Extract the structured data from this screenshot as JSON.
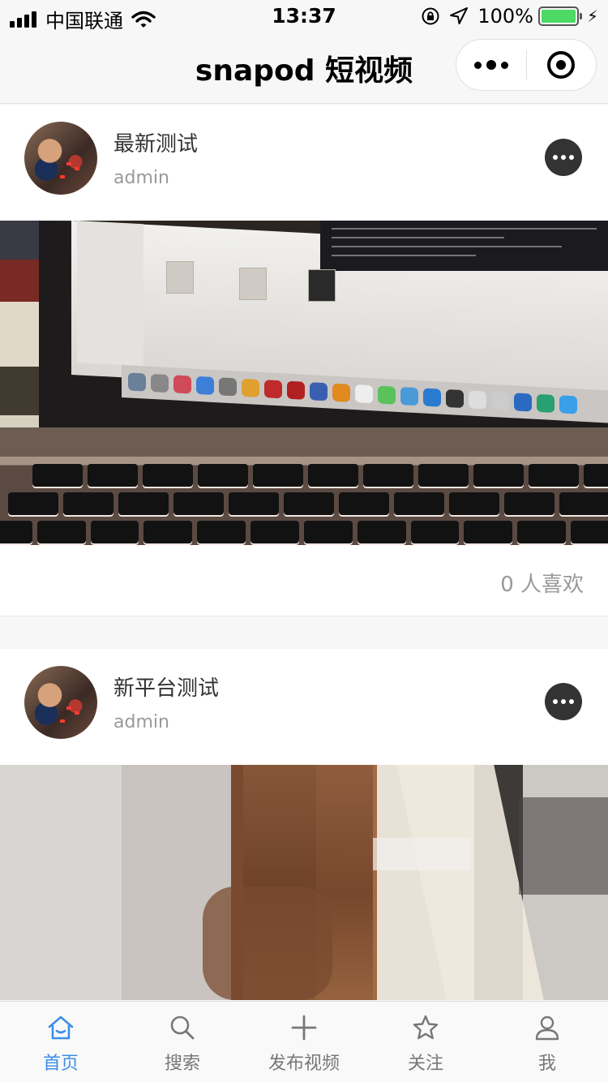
{
  "status_bar": {
    "carrier": "中国联通",
    "time": "13:37",
    "battery_percent": "100%"
  },
  "nav": {
    "title": "snapod 短视频"
  },
  "posts": [
    {
      "title": "最新测试",
      "author": "admin",
      "likes": "0 人喜欢"
    },
    {
      "title": "新平台测试",
      "author": "admin"
    }
  ],
  "tabs": [
    {
      "label": "首页",
      "icon": "home-icon",
      "active": true
    },
    {
      "label": "搜索",
      "icon": "search-icon",
      "active": false
    },
    {
      "label": "发布视频",
      "icon": "plus-icon",
      "active": false
    },
    {
      "label": "关注",
      "icon": "star-icon",
      "active": false
    },
    {
      "label": "我",
      "icon": "user-icon",
      "active": false
    }
  ],
  "colors": {
    "accent": "#3d8ee6",
    "battery": "#4cd964",
    "inactive_tab": "#777777"
  }
}
